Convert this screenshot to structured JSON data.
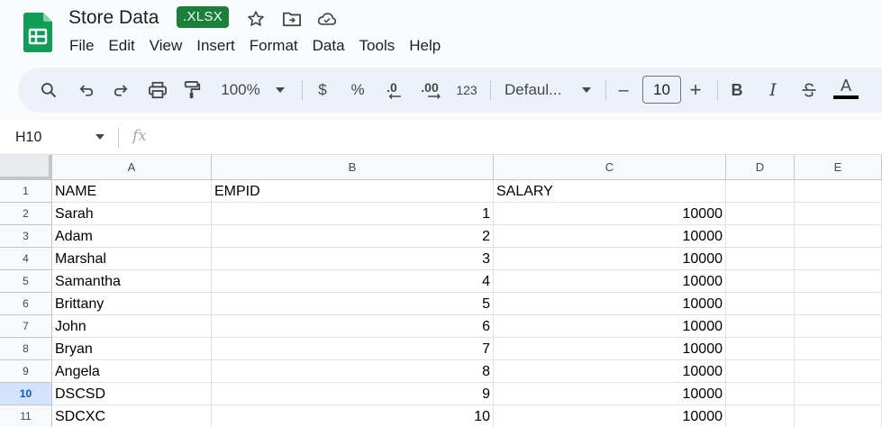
{
  "document": {
    "title": "Store Data",
    "badge": ".XLSX"
  },
  "menu": [
    "File",
    "Edit",
    "View",
    "Insert",
    "Format",
    "Data",
    "Tools",
    "Help"
  ],
  "toolbar": {
    "zoom": "100%",
    "currency": "$",
    "percent": "%",
    "decrease_decimal": ".0",
    "increase_decimal": ".00",
    "number_format": "123",
    "font": "Defaul...",
    "font_size": "10",
    "minus": "–",
    "plus": "+",
    "bold": "B",
    "italic": "I",
    "text_color": "A"
  },
  "formula_bar": {
    "name_box": "H10",
    "fx": "fx"
  },
  "grid": {
    "selected_row": 10,
    "columns": [
      "A",
      "B",
      "C",
      "D",
      "E"
    ],
    "row_numbers": [
      "1",
      "2",
      "3",
      "4",
      "5",
      "6",
      "7",
      "8",
      "9",
      "10",
      "11"
    ],
    "rows": [
      [
        "NAME",
        "EMPID",
        "SALARY",
        "",
        ""
      ],
      [
        "Sarah",
        "1",
        "10000",
        "",
        ""
      ],
      [
        "Adam",
        "2",
        "10000",
        "",
        ""
      ],
      [
        "Marshal",
        "3",
        "10000",
        "",
        ""
      ],
      [
        "Samantha",
        "4",
        "10000",
        "",
        ""
      ],
      [
        "Brittany",
        "5",
        "10000",
        "",
        ""
      ],
      [
        "John",
        "6",
        "10000",
        "",
        ""
      ],
      [
        "Bryan",
        "7",
        "10000",
        "",
        ""
      ],
      [
        "Angela",
        "8",
        "10000",
        "",
        ""
      ],
      [
        "DSCSD",
        "9",
        "10000",
        "",
        ""
      ],
      [
        "SDCXC",
        "10",
        "10000",
        "",
        ""
      ]
    ]
  },
  "colors": {
    "brand_green": "#188038",
    "selected_row_bg": "#d3e3fd",
    "selected_row_text": "#0b57d0",
    "toolbar_bg": "#edf2fa"
  }
}
